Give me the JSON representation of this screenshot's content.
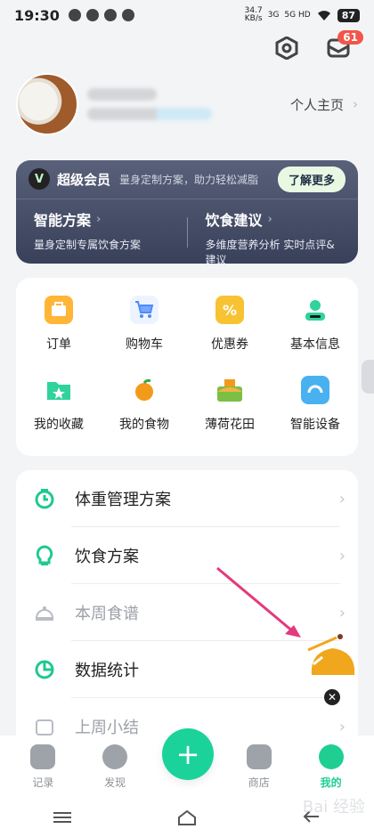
{
  "status": {
    "time": "19:30",
    "network_speed": "34.7",
    "network_unit": "KB/s",
    "signal1": "3G",
    "signal2": "5G HD",
    "battery": "87"
  },
  "header": {
    "messages_badge": "61"
  },
  "profile": {
    "link_label": "个人主页"
  },
  "vip": {
    "title": "超级会员",
    "subtitle": "量身定制方案，助力轻松减脂",
    "more_label": "了解更多",
    "plans": [
      {
        "title": "智能方案",
        "desc": "量身定制专属饮食方案"
      },
      {
        "title": "饮食建议",
        "desc": "多维度营养分析 实时点评&建议"
      }
    ]
  },
  "grid": [
    {
      "label": "订单",
      "icon": "orders-icon",
      "color": "#ffb536"
    },
    {
      "label": "购物车",
      "icon": "cart-icon",
      "color": "#4b8df8"
    },
    {
      "label": "优惠券",
      "icon": "coupon-icon",
      "color": "#f7c332"
    },
    {
      "label": "基本信息",
      "icon": "profile-info-icon",
      "color": "#2fd39b"
    },
    {
      "label": "我的收藏",
      "icon": "favorites-icon",
      "color": "#2fd39b"
    },
    {
      "label": "我的食物",
      "icon": "food-orange-icon",
      "color": "#f39a1a"
    },
    {
      "label": "薄荷花田",
      "icon": "garden-icon",
      "color": "#7bc044"
    },
    {
      "label": "智能设备",
      "icon": "smart-scale-icon",
      "color": "#4ab1f0"
    }
  ],
  "list": [
    {
      "label": "体重管理方案",
      "icon": "timer-icon",
      "dim": false
    },
    {
      "label": "饮食方案",
      "icon": "bulb-icon",
      "dim": false
    },
    {
      "label": "本周食谱",
      "icon": "cloche-icon",
      "dim": true
    },
    {
      "label": "数据统计",
      "icon": "pie-chart-icon",
      "dim": false
    },
    {
      "label": "上周小结",
      "icon": "calendar-icon",
      "dim": true
    }
  ],
  "tabs": [
    {
      "label": "记录",
      "icon": "record-icon",
      "active": false
    },
    {
      "label": "发现",
      "icon": "discover-icon",
      "active": false
    },
    {
      "label": "商店",
      "icon": "shop-icon",
      "active": false
    },
    {
      "label": "我的",
      "icon": "me-icon",
      "active": true
    }
  ],
  "fab": {
    "label": "+"
  },
  "watermark": "Bai 经验"
}
